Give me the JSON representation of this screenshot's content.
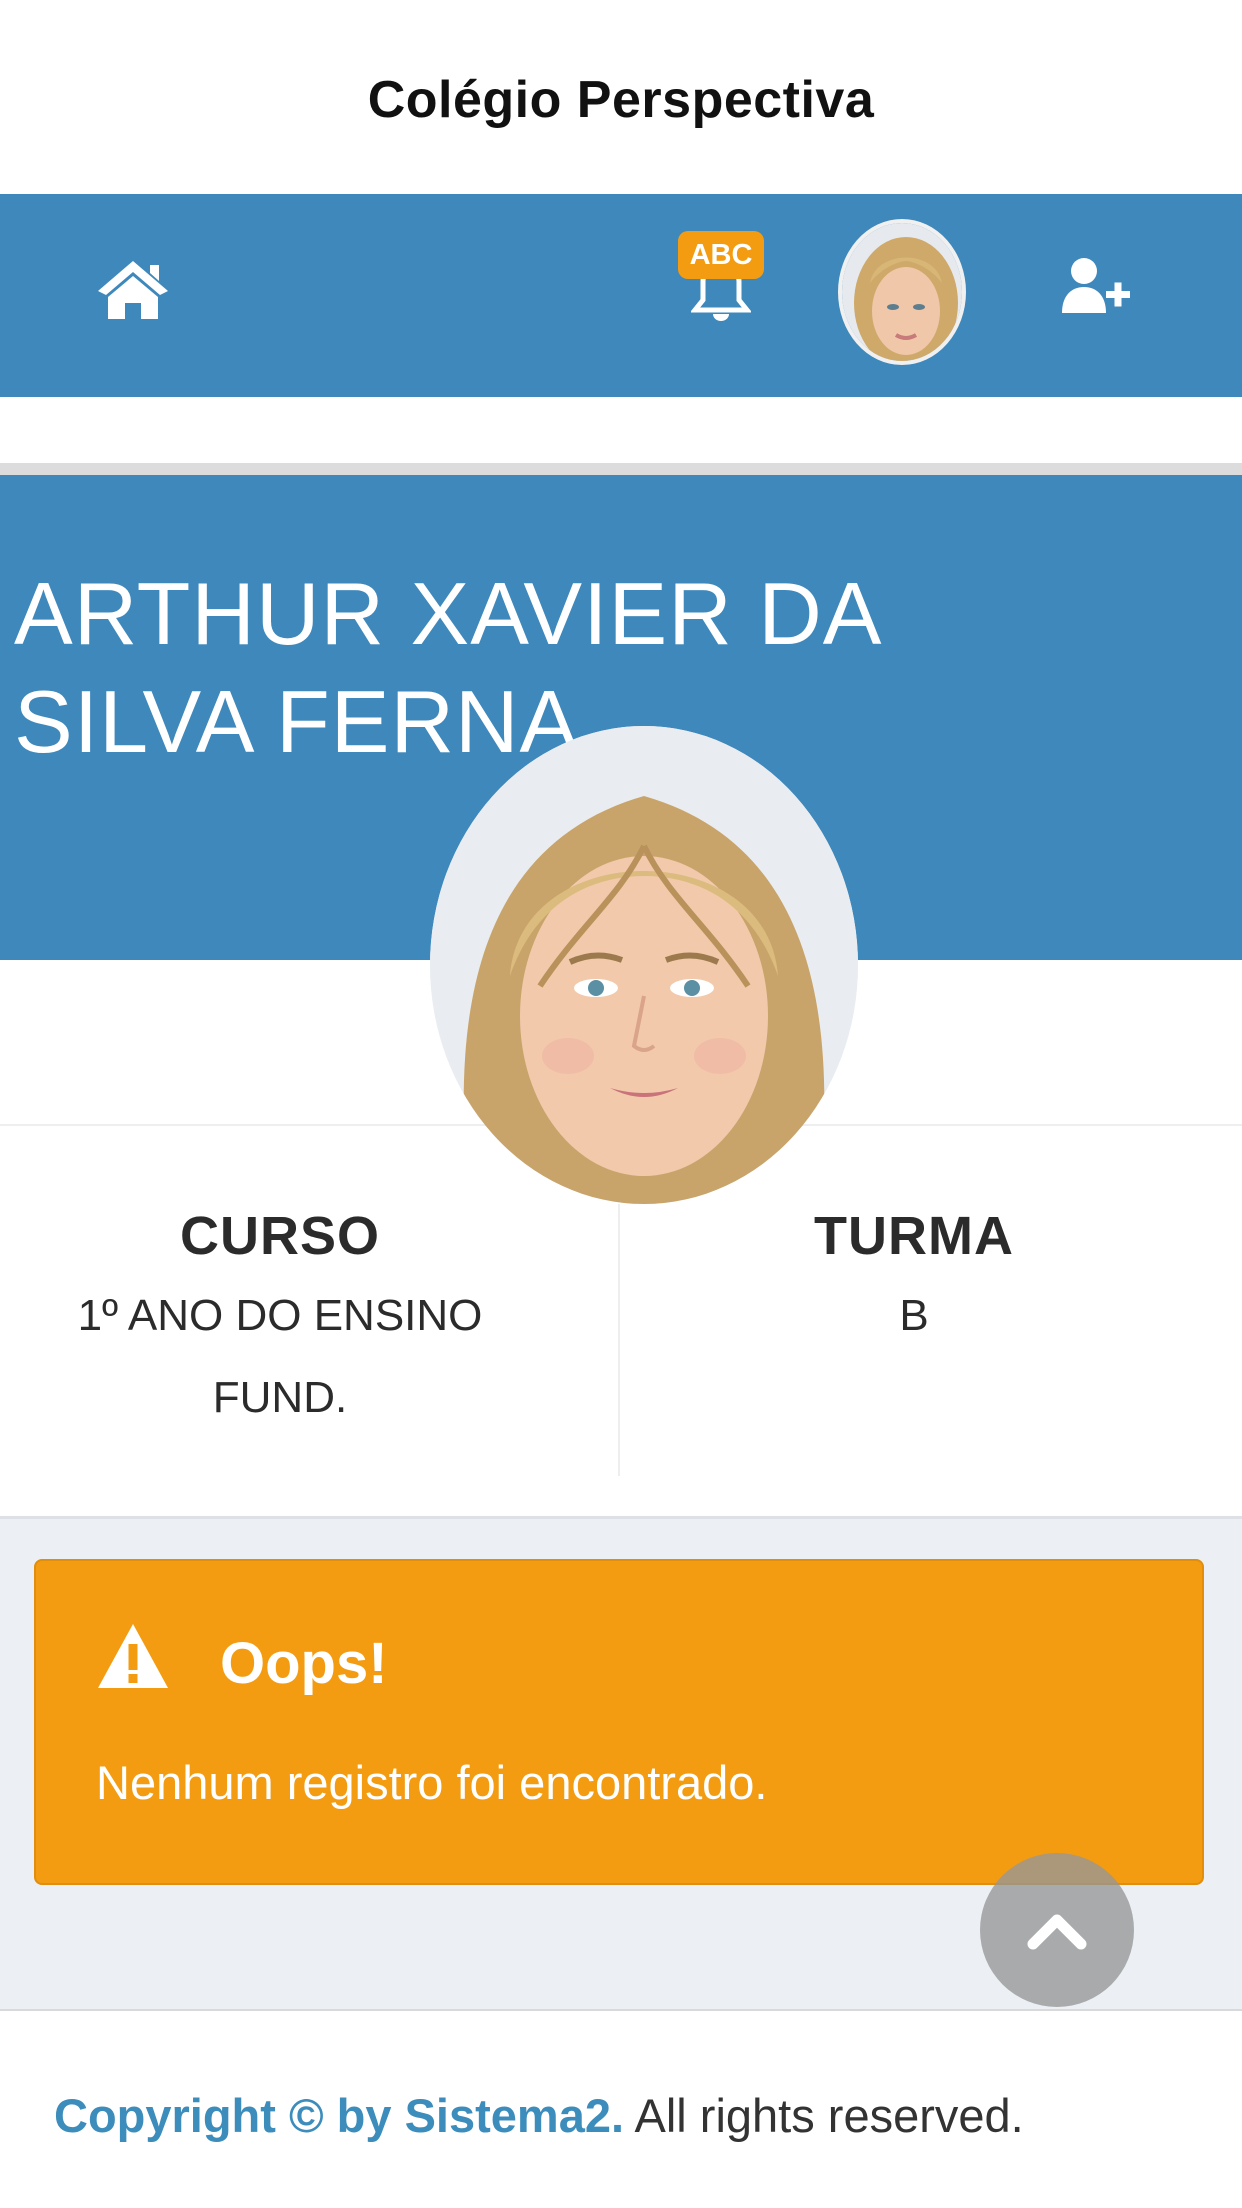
{
  "app": {
    "title": "Colégio Perspectiva"
  },
  "navbar": {
    "notification_badge": "ABC",
    "icons": [
      "home-icon",
      "bell-icon",
      "avatar",
      "user-plus-icon"
    ],
    "accent_color": "#3e88bc"
  },
  "profile": {
    "student_name": "ARTHUR XAVIER DA SILVA FERNA",
    "course_label": "CURSO",
    "course_value": "1º ANO DO ENSINO FUND.",
    "class_label": "TURMA",
    "class_value": "B"
  },
  "alert": {
    "title": "Oops!",
    "message": "Nenhum registro foi encontrado.",
    "color": "#f39c12",
    "icon": "warning-icon"
  },
  "scroll_top": {
    "icon": "chevron-up-icon"
  },
  "footer": {
    "brand": "Copyright © by Sistema2.",
    "rest": " All rights reserved."
  }
}
